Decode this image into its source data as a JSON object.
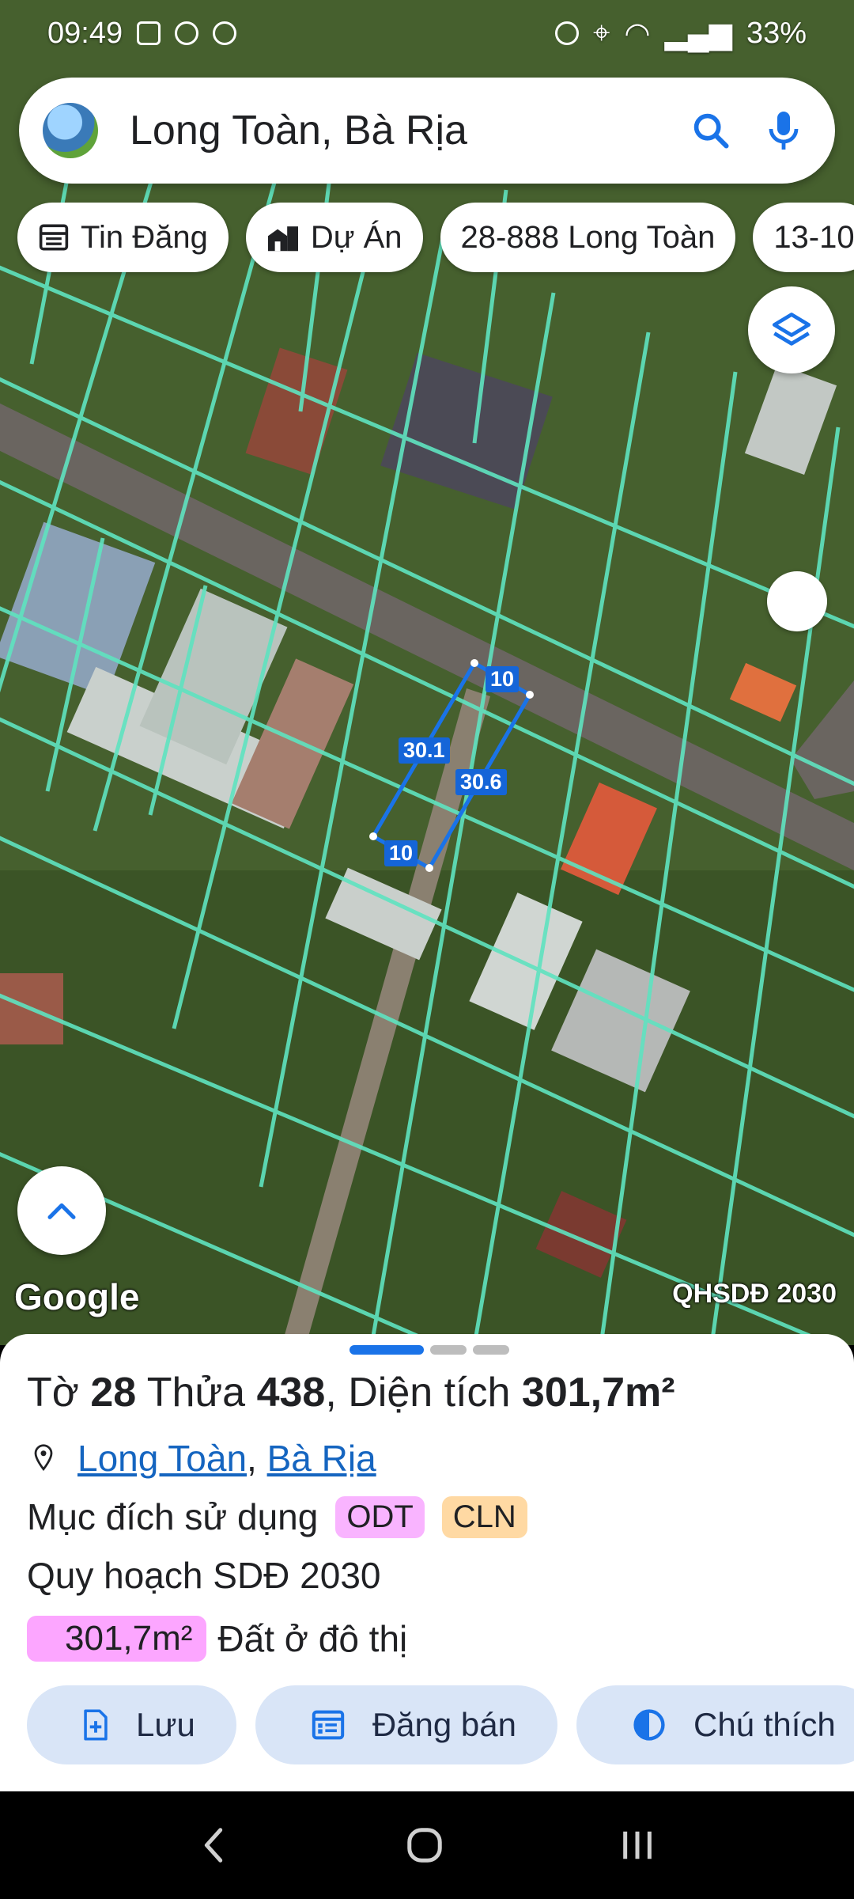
{
  "status_bar": {
    "time": "09:49",
    "battery": "33%"
  },
  "search": {
    "query": "Long Toàn, Bà Rịa"
  },
  "chips": [
    {
      "label": "Tin Đăng",
      "icon": "listing-icon"
    },
    {
      "label": "Dự Án",
      "icon": "buildings-icon"
    },
    {
      "label": "28-888 Long Toàn",
      "icon": ""
    },
    {
      "label": "13-10",
      "icon": ""
    }
  ],
  "map": {
    "attribution": "Google",
    "layer_label": "QHSDĐ 2030",
    "dimensions": [
      "10",
      "30.1",
      "30.6",
      "10"
    ]
  },
  "parcel": {
    "sheet_label": "Tờ",
    "sheet_no": "28",
    "lot_label": "Thửa",
    "lot_no": "438",
    "area_label": "Diện tích",
    "area_value": "301,7m²",
    "ward": "Long Toàn",
    "city": "Bà Rịa",
    "usage_label": "Mục đích sử dụng",
    "usage_codes": [
      {
        "code": "ODT",
        "color": "#f9b4ff"
      },
      {
        "code": "CLN",
        "color": "#ffd9a3"
      }
    ],
    "plan_title": "Quy hoạch SDĐ 2030",
    "plan_area": "301,7m²",
    "plan_area_color": "#fca6ff",
    "plan_use": "Đất ở đô thị"
  },
  "actions": [
    {
      "label": "Lưu",
      "icon": "save-file-icon"
    },
    {
      "label": "Đăng bán",
      "icon": "post-sale-icon"
    },
    {
      "label": "Chú thích",
      "icon": "legend-icon"
    }
  ],
  "colors": {
    "accent": "#1a73e8",
    "parcel_lines": "#5fe3c0",
    "action_bg": "#d9e5f7"
  }
}
